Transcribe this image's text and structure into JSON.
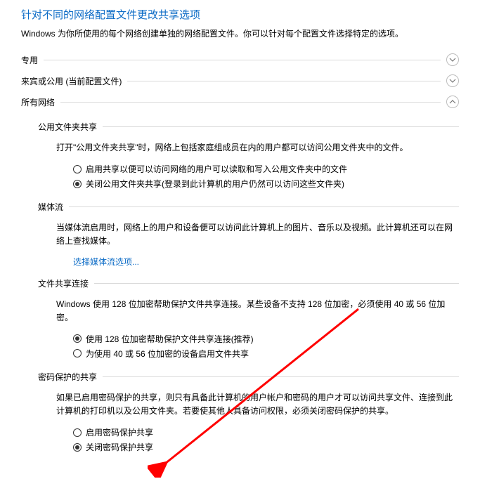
{
  "header": {
    "title": "针对不同的网络配置文件更改共享选项",
    "subtitle": "Windows 为你所使用的每个网络创建单独的网络配置文件。你可以针对每个配置文件选择特定的选项。"
  },
  "profiles": {
    "private": {
      "label": "专用"
    },
    "guest": {
      "label": "来宾或公用 (当前配置文件)"
    },
    "all": {
      "label": "所有网络"
    }
  },
  "public_folder": {
    "title": "公用文件夹共享",
    "desc": "打开\"公用文件夹共享\"时，网络上包括家庭组成员在内的用户都可以访问公用文件夹中的文件。",
    "opt_on": "启用共享以便可以访问网络的用户可以读取和写入公用文件夹中的文件",
    "opt_off": "关闭公用文件夹共享(登录到此计算机的用户仍然可以访问这些文件夹)"
  },
  "media": {
    "title": "媒体流",
    "desc": "当媒体流启用时，网络上的用户和设备便可以访问此计算机上的图片、音乐以及视频。此计算机还可以在网络上查找媒体。",
    "link": "选择媒体流选项..."
  },
  "encryption": {
    "title": "文件共享连接",
    "desc": "Windows 使用 128 位加密帮助保护文件共享连接。某些设备不支持 128 位加密，必须使用 40 或 56 位加密。",
    "opt_128": "使用 128 位加密帮助保护文件共享连接(推荐)",
    "opt_4056": "为使用 40 或 56 位加密的设备启用文件共享"
  },
  "password": {
    "title": "密码保护的共享",
    "desc": "如果已启用密码保护的共享，则只有具备此计算机的用户帐户和密码的用户才可以访问共享文件、连接到此计算机的打印机以及公用文件夹。若要使其他人具备访问权限，必须关闭密码保护的共享。",
    "opt_on": "启用密码保护共享",
    "opt_off": "关闭密码保护共享"
  }
}
